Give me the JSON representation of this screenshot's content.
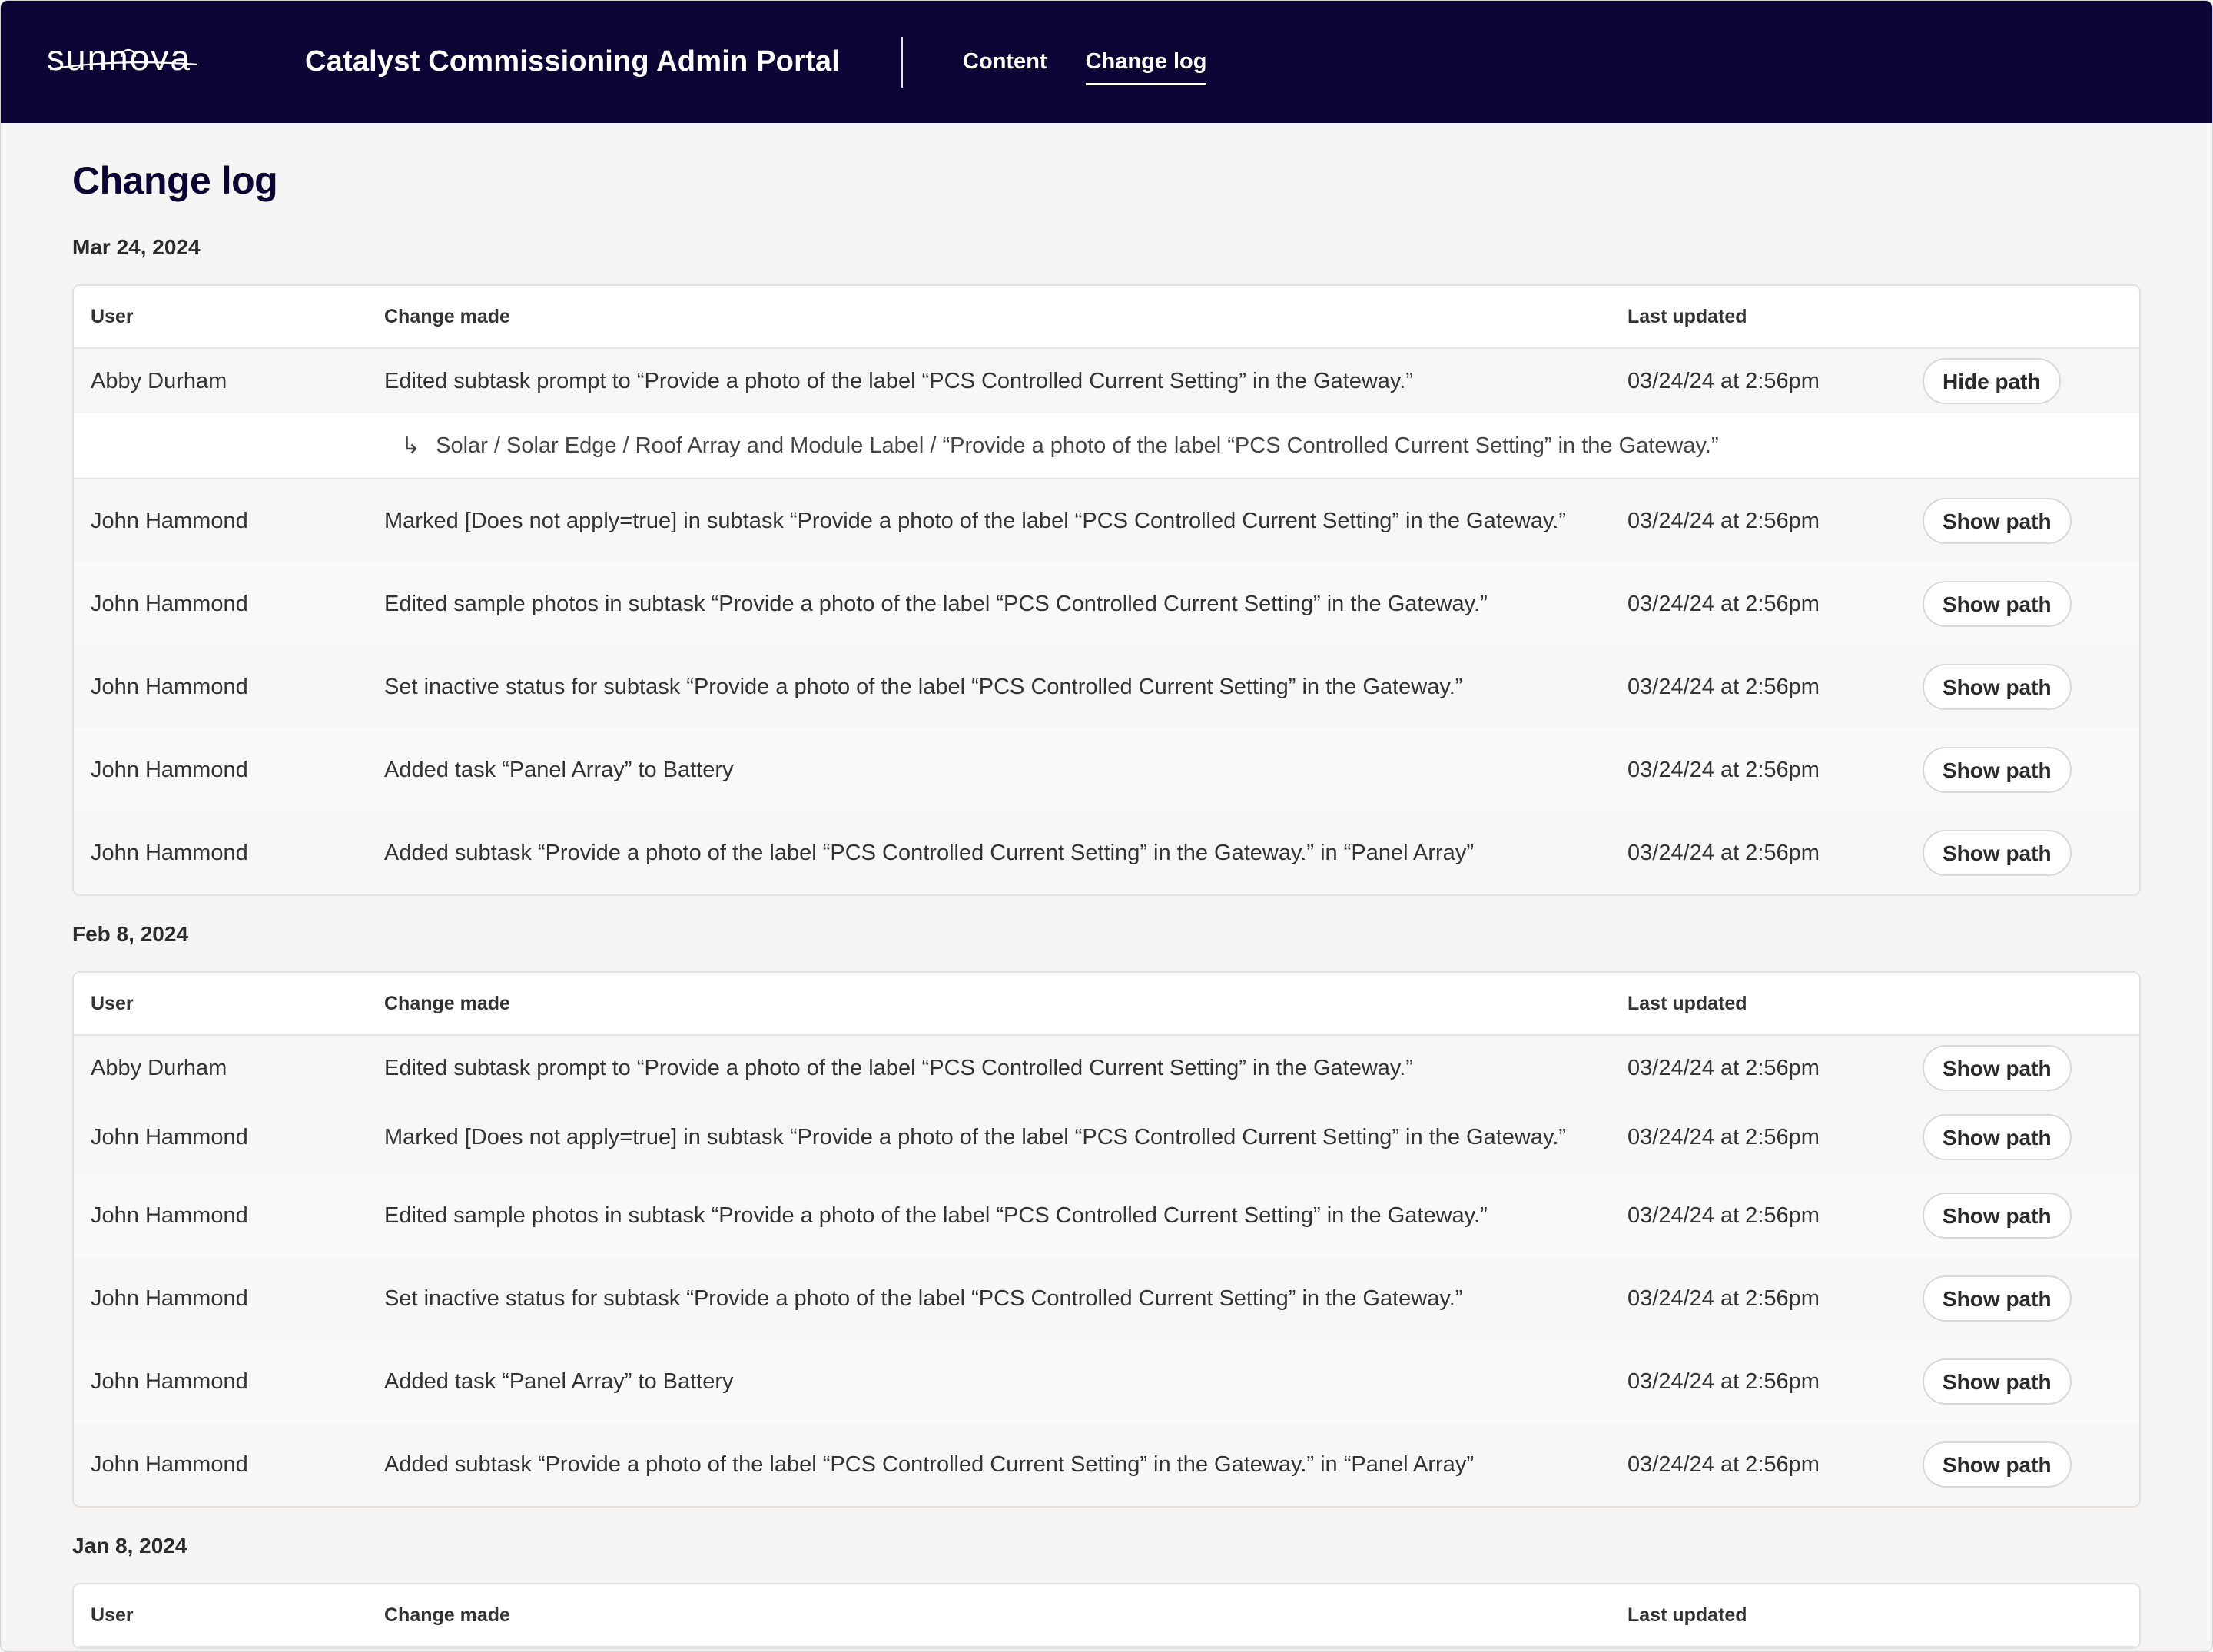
{
  "header": {
    "logo_text": "sunnova",
    "app_title": "Catalyst Commissioning Admin Portal",
    "nav": [
      {
        "label": "Content",
        "active": false
      },
      {
        "label": "Change log",
        "active": true
      }
    ]
  },
  "page": {
    "title": "Change log",
    "columns": {
      "user": "User",
      "change": "Change made",
      "updated": "Last updated"
    }
  },
  "groups": [
    {
      "date": "Mar 24, 2024",
      "rows": [
        {
          "user": "Abby Durham",
          "change": "Edited subtask prompt to “Provide a photo of the label “PCS Controlled Current Setting” in the Gateway.”",
          "updated": "03/24/24 at 2:56pm",
          "action": "Hide path",
          "path": "Solar / Solar Edge / Roof Array and Module Label / “Provide a photo of the label “PCS Controlled Current Setting” in the Gateway.”"
        },
        {
          "user": "John Hammond",
          "change": "Marked [Does not apply=true] in subtask “Provide a photo of the label “PCS Controlled Current Setting” in the Gateway.”",
          "updated": "03/24/24 at 2:56pm",
          "action": "Show path"
        },
        {
          "user": "John Hammond",
          "change": "Edited sample photos in subtask “Provide a photo of the label “PCS Controlled Current Setting” in the Gateway.”",
          "updated": "03/24/24 at 2:56pm",
          "action": "Show path"
        },
        {
          "user": "John Hammond",
          "change": "Set inactive status for subtask “Provide a photo of the label “PCS Controlled Current Setting” in the Gateway.”",
          "updated": "03/24/24 at 2:56pm",
          "action": "Show path"
        },
        {
          "user": "John Hammond",
          "change": "Added task “Panel Array” to Battery",
          "updated": "03/24/24 at 2:56pm",
          "action": "Show path"
        },
        {
          "user": "John Hammond",
          "change": "Added subtask  “Provide a photo of the label “PCS Controlled Current Setting” in the Gateway.” in “Panel Array”",
          "updated": "03/24/24 at 2:56pm",
          "action": "Show path"
        }
      ]
    },
    {
      "date": "Feb 8, 2024",
      "rows": [
        {
          "user": "Abby Durham",
          "change": "Edited subtask prompt to “Provide a photo of the label “PCS Controlled Current Setting” in the Gateway.”",
          "updated": "03/24/24 at 2:56pm",
          "action": "Show path"
        },
        {
          "user": "John Hammond",
          "change": "Marked [Does not apply=true] in subtask “Provide a photo of the label “PCS Controlled Current Setting” in the Gateway.”",
          "updated": "03/24/24 at 2:56pm",
          "action": "Show path"
        },
        {
          "user": "John Hammond",
          "change": "Edited sample photos in subtask “Provide a photo of the label “PCS Controlled Current Setting” in the Gateway.”",
          "updated": "03/24/24 at 2:56pm",
          "action": "Show path"
        },
        {
          "user": "John Hammond",
          "change": "Set inactive status for subtask “Provide a photo of the label “PCS Controlled Current Setting” in the Gateway.”",
          "updated": "03/24/24 at 2:56pm",
          "action": "Show path"
        },
        {
          "user": "John Hammond",
          "change": "Added task “Panel Array” to Battery",
          "updated": "03/24/24 at 2:56pm",
          "action": "Show path"
        },
        {
          "user": "John Hammond",
          "change": "Added subtask  “Provide a photo of the label “PCS Controlled Current Setting” in the Gateway.” in “Panel Array”",
          "updated": "03/24/24 at 2:56pm",
          "action": "Show path"
        }
      ]
    },
    {
      "date": "Jan 8, 2024",
      "rows": []
    }
  ],
  "colors": {
    "header_bg": "#0c0434",
    "title": "#0c0434",
    "page_bg": "#f6f5f3"
  }
}
